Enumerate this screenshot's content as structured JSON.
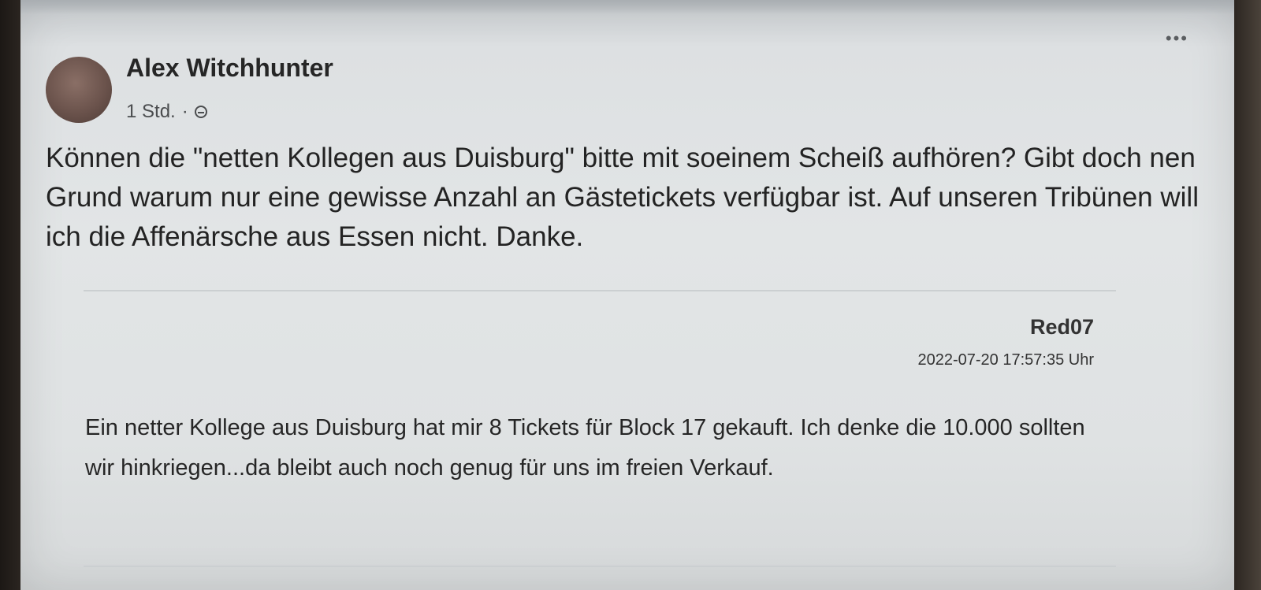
{
  "post": {
    "author": "Alex Witchhunter",
    "time": "1 Std.",
    "separator": "·",
    "visibility_icon": "globe-icon",
    "menu_icon": "more-options-icon",
    "menu_glyph": "•••",
    "text": "Können die \"netten Kollegen aus Duisburg\" bitte mit soeinem Scheiß aufhören? Gibt doch nen Grund warum nur eine gewisse Anzahl an Gästetickets verfügbar ist. Auf unseren Tribünen will ich die Affenärsche aus Essen nicht. Danke."
  },
  "quote": {
    "username": "Red07",
    "timestamp": "2022-07-20 17:57:35 Uhr",
    "text": "Ein netter Kollege aus Duisburg hat mir 8 Tickets für Block 17 gekauft. Ich denke die 10.000 sollten wir hinkriegen...da bleibt auch noch genug für uns im freien Verkauf."
  }
}
